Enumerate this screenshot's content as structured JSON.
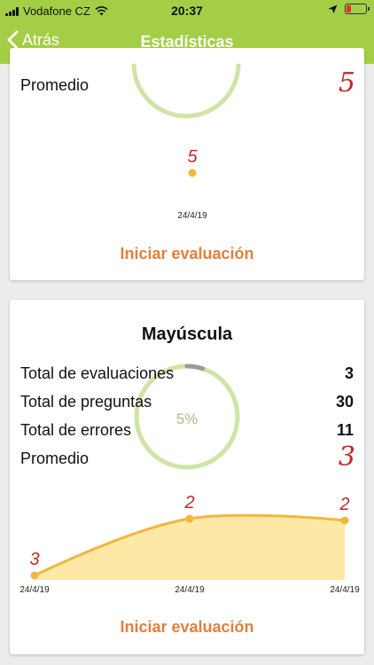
{
  "status_bar": {
    "carrier": "Vodafone CZ",
    "time": "20:37",
    "battery_color": "#e5322e"
  },
  "nav": {
    "back_label": "Atrás",
    "title": "Estadísticas"
  },
  "colors": {
    "accent": "#a4ce45",
    "action": "#e27f3c",
    "average": "#c62828",
    "chart_line": "#f2b63f",
    "chart_fill": "#fde8a6"
  },
  "card_minuscula": {
    "average_label": "Promedio",
    "average_value": "5",
    "action_label": "Iniciar evaluación"
  },
  "card_mayuscula": {
    "title": "Mayúscula",
    "stats": [
      {
        "label": "Total de evaluaciones",
        "value": "3"
      },
      {
        "label": "Total de preguntas",
        "value": "30"
      },
      {
        "label": "Total de errores",
        "value": "11"
      }
    ],
    "average_label": "Promedio",
    "average_value": "3",
    "error_rate": "5%",
    "action_label": "Iniciar evaluación"
  },
  "chart_data": [
    {
      "type": "line",
      "x": [
        "24/4/19"
      ],
      "series": [
        {
          "values": [
            5
          ]
        }
      ]
    },
    {
      "type": "area",
      "x": [
        "24/4/19",
        "24/4/19",
        "24/4/19"
      ],
      "series": [
        {
          "values": [
            3,
            2,
            2
          ]
        }
      ],
      "grid": false
    }
  ]
}
